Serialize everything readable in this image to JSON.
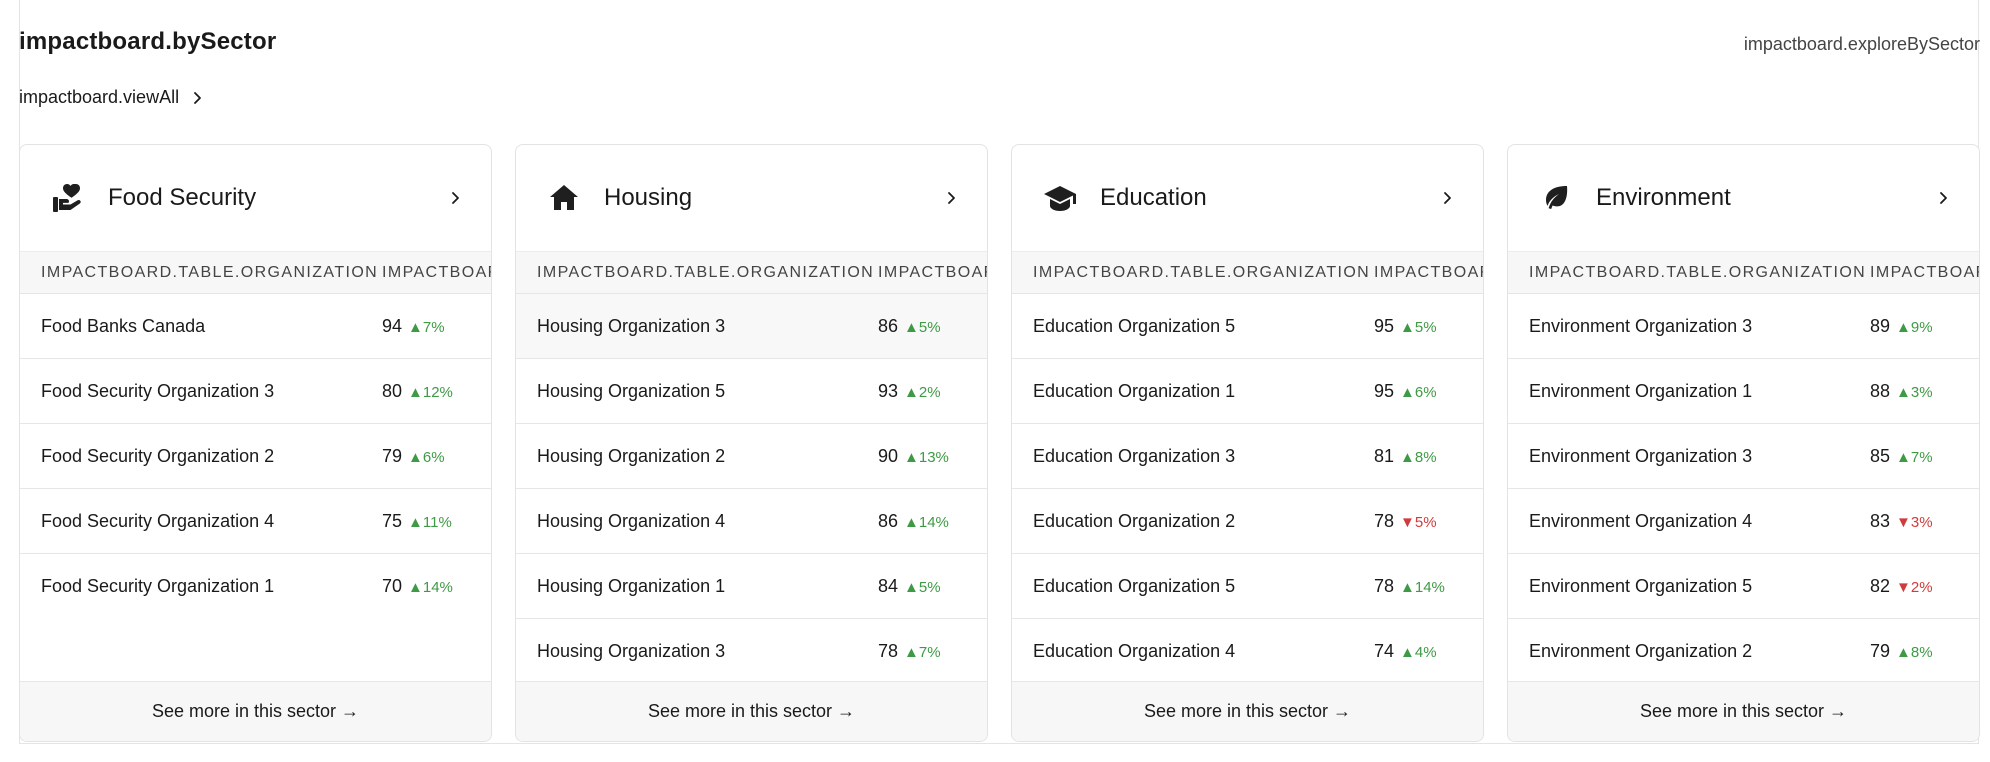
{
  "header": {
    "title": "impactboard.bySector",
    "explore_link": "impactboard.exploreBySector",
    "view_all": "impactboard.viewAll"
  },
  "colors": {
    "up": "#3e9a45",
    "down": "#d23b3b"
  },
  "table": {
    "col_org": "IMPACTBOARD.TABLE.ORGANIZATION",
    "col_score": "IMPACTBOARD.TABLE.SCORE"
  },
  "footer_label": "See more in this sector →",
  "sectors": [
    {
      "name": "Food Security",
      "icon": "hand-heart-icon",
      "rows": [
        {
          "org": "Food Banks Canada",
          "score": "94",
          "delta": "▲7%",
          "dir": "up"
        },
        {
          "org": "Food Security Organization 3",
          "score": "80",
          "delta": "▲12%",
          "dir": "up"
        },
        {
          "org": "Food Security Organization 2",
          "score": "79",
          "delta": "▲6%",
          "dir": "up"
        },
        {
          "org": "Food Security Organization 4",
          "score": "75",
          "delta": "▲11%",
          "dir": "up"
        },
        {
          "org": "Food Security Organization 1",
          "score": "70",
          "delta": "▲14%",
          "dir": "up"
        }
      ]
    },
    {
      "name": "Housing",
      "icon": "home-icon",
      "rows": [
        {
          "org": "Housing Organization 3",
          "score": "86",
          "delta": "▲5%",
          "dir": "up"
        },
        {
          "org": "Housing Organization 5",
          "score": "93",
          "delta": "▲2%",
          "dir": "up"
        },
        {
          "org": "Housing Organization 2",
          "score": "90",
          "delta": "▲13%",
          "dir": "up"
        },
        {
          "org": "Housing Organization 4",
          "score": "86",
          "delta": "▲14%",
          "dir": "up"
        },
        {
          "org": "Housing Organization 1",
          "score": "84",
          "delta": "▲5%",
          "dir": "up"
        },
        {
          "org": "Housing Organization 3",
          "score": "78",
          "delta": "▲7%",
          "dir": "up"
        }
      ]
    },
    {
      "name": "Education",
      "icon": "graduation-cap-icon",
      "rows": [
        {
          "org": "Education Organization 5",
          "score": "95",
          "delta": "▲5%",
          "dir": "up"
        },
        {
          "org": "Education Organization 1",
          "score": "95",
          "delta": "▲6%",
          "dir": "up"
        },
        {
          "org": "Education Organization 3",
          "score": "81",
          "delta": "▲8%",
          "dir": "up"
        },
        {
          "org": "Education Organization 2",
          "score": "78",
          "delta": "▼5%",
          "dir": "down"
        },
        {
          "org": "Education Organization 5",
          "score": "78",
          "delta": "▲14%",
          "dir": "up"
        },
        {
          "org": "Education Organization 4",
          "score": "74",
          "delta": "▲4%",
          "dir": "up"
        }
      ]
    },
    {
      "name": "Environment",
      "icon": "leaf-icon",
      "rows": [
        {
          "org": "Environment Organization 3",
          "score": "89",
          "delta": "▲9%",
          "dir": "up"
        },
        {
          "org": "Environment Organization 1",
          "score": "88",
          "delta": "▲3%",
          "dir": "up"
        },
        {
          "org": "Environment Organization 3",
          "score": "85",
          "delta": "▲7%",
          "dir": "up"
        },
        {
          "org": "Environment Organization 4",
          "score": "83",
          "delta": "▼3%",
          "dir": "down"
        },
        {
          "org": "Environment Organization 5",
          "score": "82",
          "delta": "▼2%",
          "dir": "down"
        },
        {
          "org": "Environment Organization 2",
          "score": "79",
          "delta": "▲8%",
          "dir": "up"
        }
      ]
    }
  ]
}
